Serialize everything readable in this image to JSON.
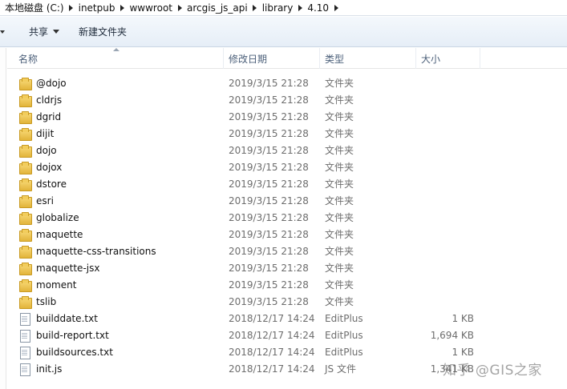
{
  "breadcrumb": [
    "本地磁盘 (C:)",
    "inetpub",
    "wwwroot",
    "arcgis_js_api",
    "library",
    "4.10"
  ],
  "toolbar": {
    "share_label": "共享",
    "new_folder_label": "新建文件夹"
  },
  "columns": {
    "name": "名称",
    "date": "修改日期",
    "type": "类型",
    "size": "大小"
  },
  "files": [
    {
      "name": "@dojo",
      "date": "2019/3/15 21:28",
      "type": "文件夹",
      "size": "",
      "icon": "folder-icon"
    },
    {
      "name": "cldrjs",
      "date": "2019/3/15 21:28",
      "type": "文件夹",
      "size": "",
      "icon": "folder-icon"
    },
    {
      "name": "dgrid",
      "date": "2019/3/15 21:28",
      "type": "文件夹",
      "size": "",
      "icon": "folder-icon"
    },
    {
      "name": "dijit",
      "date": "2019/3/15 21:28",
      "type": "文件夹",
      "size": "",
      "icon": "folder-icon"
    },
    {
      "name": "dojo",
      "date": "2019/3/15 21:28",
      "type": "文件夹",
      "size": "",
      "icon": "folder-icon"
    },
    {
      "name": "dojox",
      "date": "2019/3/15 21:28",
      "type": "文件夹",
      "size": "",
      "icon": "folder-icon"
    },
    {
      "name": "dstore",
      "date": "2019/3/15 21:28",
      "type": "文件夹",
      "size": "",
      "icon": "folder-icon"
    },
    {
      "name": "esri",
      "date": "2019/3/15 21:28",
      "type": "文件夹",
      "size": "",
      "icon": "folder-icon"
    },
    {
      "name": "globalize",
      "date": "2019/3/15 21:28",
      "type": "文件夹",
      "size": "",
      "icon": "folder-icon"
    },
    {
      "name": "maquette",
      "date": "2019/3/15 21:28",
      "type": "文件夹",
      "size": "",
      "icon": "folder-icon"
    },
    {
      "name": "maquette-css-transitions",
      "date": "2019/3/15 21:28",
      "type": "文件夹",
      "size": "",
      "icon": "folder-icon"
    },
    {
      "name": "maquette-jsx",
      "date": "2019/3/15 21:28",
      "type": "文件夹",
      "size": "",
      "icon": "folder-icon"
    },
    {
      "name": "moment",
      "date": "2019/3/15 21:28",
      "type": "文件夹",
      "size": "",
      "icon": "folder-icon"
    },
    {
      "name": "tslib",
      "date": "2019/3/15 21:28",
      "type": "文件夹",
      "size": "",
      "icon": "folder-icon"
    },
    {
      "name": "builddate.txt",
      "date": "2018/12/17 14:24",
      "type": "EditPlus",
      "size": "1 KB",
      "icon": "file-icon"
    },
    {
      "name": "build-report.txt",
      "date": "2018/12/17 14:24",
      "type": "EditPlus",
      "size": "1,694 KB",
      "icon": "file-icon"
    },
    {
      "name": "buildsources.txt",
      "date": "2018/12/17 14:24",
      "type": "EditPlus",
      "size": "1 KB",
      "icon": "file-icon"
    },
    {
      "name": "init.js",
      "date": "2018/12/17 14:24",
      "type": "JS 文件",
      "size": "1,341 KB",
      "icon": "file-icon"
    }
  ],
  "watermark": "知乎 @GIS之家"
}
